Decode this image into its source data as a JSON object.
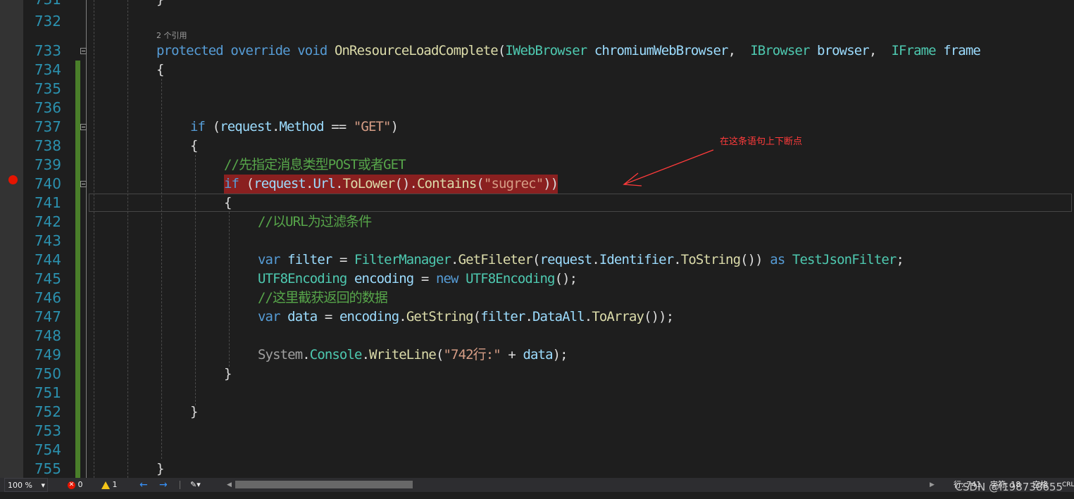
{
  "editor": {
    "reference_count": "2 个引用",
    "line_numbers": [
      "731",
      "732",
      "733",
      "734",
      "735",
      "736",
      "737",
      "738",
      "739",
      "740",
      "741",
      "742",
      "743",
      "744",
      "745",
      "746",
      "747",
      "748",
      "749",
      "750",
      "751",
      "752",
      "753",
      "754",
      "755"
    ],
    "code": {
      "l731": {
        "brace": "}"
      },
      "l733": {
        "k1": "protected",
        "k2": "override",
        "k3": "void",
        "fn": "OnResourceLoadComplete",
        "p1": "(",
        "t1": "IWebBrowser",
        "a1": "chromiumWebBrowser",
        "c1": ",",
        "t2": "IBrowser",
        "a2": "browser",
        "c2": ",",
        "t3": "IFrame",
        "a3": "frame"
      },
      "l734": {
        "brace": "{"
      },
      "l737": {
        "kw": "if",
        "open": " (",
        "id": "request",
        "dot": ".",
        "prop": "Method",
        "op": " == ",
        "str": "\"GET\"",
        "close": ")"
      },
      "l738": {
        "brace": "{"
      },
      "l739": {
        "comment": "//先指定消息类型POST或者GET"
      },
      "l740": {
        "kw": "if",
        "open": " (",
        "id": "request",
        "d1": ".",
        "p1": "Url",
        "d2": ".",
        "m1": "ToLower",
        "pp": "()",
        "d3": ".",
        "m2": "Contains",
        "o2": "(",
        "str": "\"sugrec\"",
        "close": "))"
      },
      "l741": {
        "brace": "{"
      },
      "l742": {
        "comment": "//以URL为过滤条件"
      },
      "l744": {
        "kw": "var",
        "id": "filter",
        "eq": " = ",
        "ty": "FilterManager",
        "d1": ".",
        "m1": "GetFileter",
        "o1": "(",
        "a1": "request",
        "d2": ".",
        "p1": "Identifier",
        "d3": ".",
        "m2": "ToString",
        "c1": "())",
        "as": "as",
        "ty2": "TestJsonFilter",
        "semi": ";"
      },
      "l745": {
        "ty": "UTF8Encoding",
        "id": "encoding",
        "eq": " = ",
        "kw": "new",
        "ty2": "UTF8Encoding",
        "rest": "();"
      },
      "l746": {
        "comment": "//这里截获返回的数据"
      },
      "l747": {
        "kw": "var",
        "id": "data",
        "eq": " = ",
        "a1": "encoding",
        "d1": ".",
        "m1": "GetString",
        "o1": "(",
        "a2": "filter",
        "d2": ".",
        "p1": "DataAll",
        "d3": ".",
        "m2": "ToArray",
        "rest": "());"
      },
      "l749": {
        "ns": "System",
        "d1": ".",
        "ty": "Console",
        "d2": ".",
        "m1": "WriteLine",
        "o1": "(",
        "str": "\"742行:\"",
        "plus": " + ",
        "a1": "data",
        "rest": ");"
      },
      "l750": {
        "brace": "}"
      },
      "l752": {
        "brace": "}"
      },
      "l755": {
        "brace": "}"
      }
    },
    "annotation_text": "在这条语句上下断点"
  },
  "status_bar": {
    "zoom": "100 %",
    "zoom_arrow": "▾",
    "errors": "0",
    "warnings": "1",
    "back": "←",
    "forward": "→",
    "brush": "✎▾",
    "scroll_left": "◀",
    "scroll_right": "▶",
    "row": "行: 741",
    "col": "字符: 18",
    "spaces": "空格",
    "crlf": "CRLF"
  },
  "watermark": "CSDN @l198738655",
  "colors": {
    "breakpoint": "#e51400",
    "breakpoint_highlight": "#8a2020",
    "annotation": "#ff3b3b",
    "keyword": "#569cd6",
    "type": "#4ec9b0",
    "method": "#dcdcaa",
    "comment": "#57a64a",
    "string": "#d69d85",
    "line_number": "#2b91af"
  }
}
